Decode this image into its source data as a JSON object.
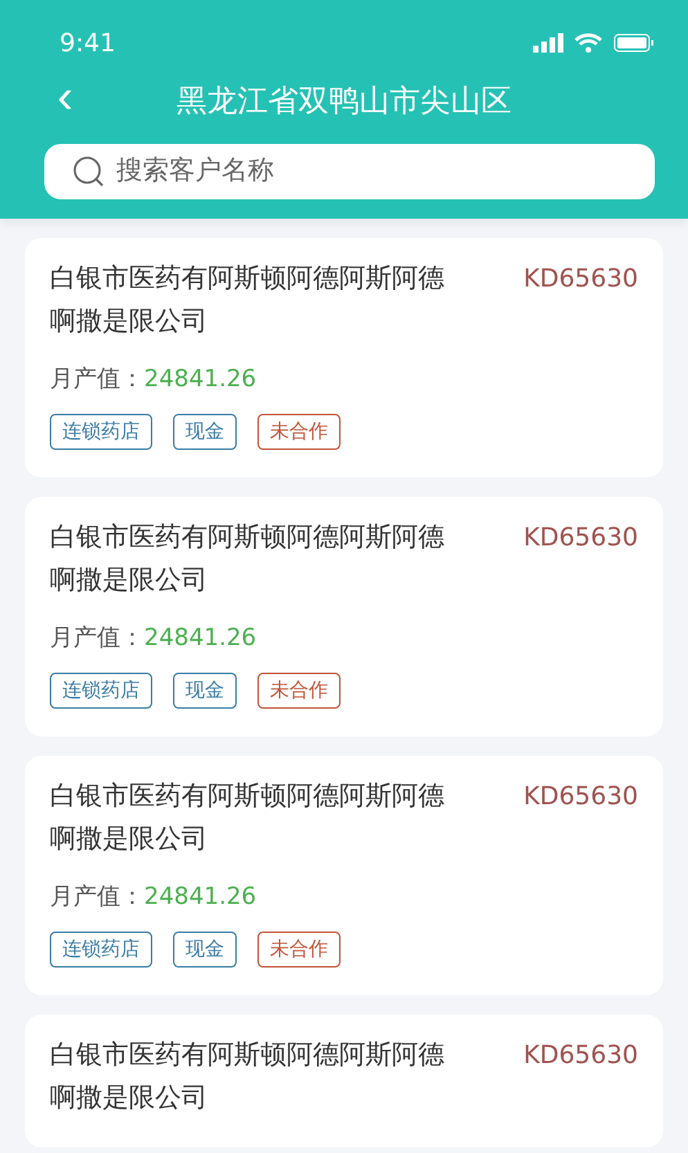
{
  "status_bar": {
    "time": "9:41"
  },
  "header": {
    "back": "‹",
    "title": "黑龙江省双鸭山市尖山区"
  },
  "search": {
    "placeholder": "搜索客户名称"
  },
  "customers": [
    {
      "name": "白银市医药有阿斯顿阿德阿斯阿德啊撒是限公司",
      "code": "KD65630",
      "output_label": "月产值：",
      "output_value": "24841.26",
      "tags": [
        {
          "label": "连锁药店",
          "color": "#3a7ca5"
        },
        {
          "label": "现金",
          "color": "#3a7ca5"
        },
        {
          "label": "未合作",
          "color": "#c0553a"
        }
      ]
    },
    {
      "name": "白银市医药有阿斯顿阿德阿斯阿德啊撒是限公司",
      "code": "KD65630",
      "output_label": "月产值：",
      "output_value": "24841.26",
      "tags": [
        {
          "label": "连锁药店",
          "color": "#3a7ca5"
        },
        {
          "label": "现金",
          "color": "#3a7ca5"
        },
        {
          "label": "未合作",
          "color": "#c0553a"
        }
      ]
    },
    {
      "name": "白银市医药有阿斯顿阿德阿斯阿德啊撒是限公司",
      "code": "KD65630",
      "output_label": "月产值：",
      "output_value": "24841.26",
      "tags": [
        {
          "label": "连锁药店",
          "color": "#3a7ca5"
        },
        {
          "label": "现金",
          "color": "#3a7ca5"
        },
        {
          "label": "未合作",
          "color": "#c0553a"
        }
      ]
    },
    {
      "name": "白银市医药有阿斯顿阿德阿斯阿德啊撒是限公司",
      "code": "KD65630"
    }
  ]
}
